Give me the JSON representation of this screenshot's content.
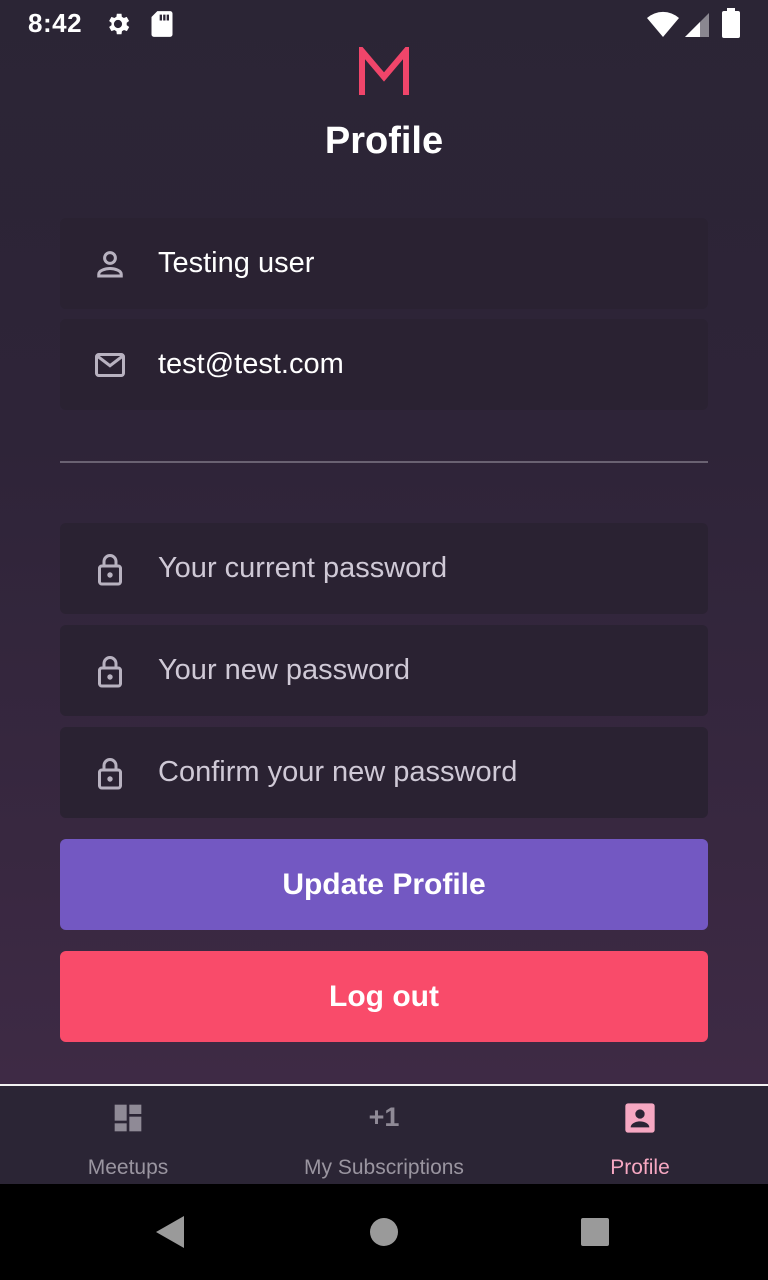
{
  "status_bar": {
    "time": "8:42"
  },
  "header": {
    "title": "Profile",
    "logo": "M"
  },
  "profile": {
    "name_value": "Testing user",
    "email_value": "test@test.com"
  },
  "password": {
    "current_placeholder": "Your current password",
    "new_placeholder": "Your new password",
    "confirm_placeholder": "Confirm your new password"
  },
  "buttons": {
    "update_label": "Update Profile",
    "logout_label": "Log out"
  },
  "bottom_nav": {
    "items": [
      {
        "label": "Meetups",
        "icon": "dashboard-icon",
        "active": false
      },
      {
        "label": "My Subscriptions",
        "icon_text": "+1",
        "active": false
      },
      {
        "label": "Profile",
        "icon": "profile-card-icon",
        "active": true
      }
    ]
  },
  "colors": {
    "accent_purple": "#7358c2",
    "accent_red": "#f94b6a",
    "active_nav": "#f6a8c2",
    "logo": "#f0456a"
  }
}
